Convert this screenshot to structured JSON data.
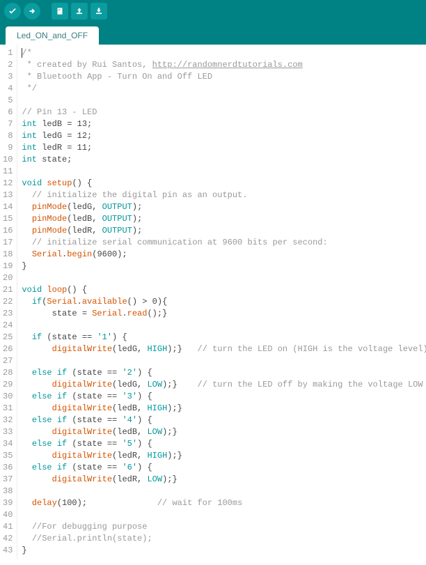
{
  "tab": {
    "title": "Led_ON_and_OFF"
  },
  "toolbar": {
    "verify": "verify-icon",
    "upload": "upload-icon",
    "new": "new-icon",
    "open": "open-icon",
    "save": "save-icon"
  },
  "code": {
    "lines": [
      {
        "n": 1,
        "seg": [
          {
            "c": "cm",
            "t": "/*"
          }
        ],
        "cursor": true
      },
      {
        "n": 2,
        "seg": [
          {
            "c": "cm",
            "t": " * created by Rui Santos, "
          },
          {
            "c": "cm-u",
            "t": "http://randomnerdtutorials.com"
          }
        ]
      },
      {
        "n": 3,
        "seg": [
          {
            "c": "cm",
            "t": " * Bluetooth App - Turn On and Off LED"
          }
        ]
      },
      {
        "n": 4,
        "seg": [
          {
            "c": "cm",
            "t": " */"
          }
        ]
      },
      {
        "n": 5,
        "seg": []
      },
      {
        "n": 6,
        "seg": [
          {
            "c": "cm",
            "t": "// Pin 13 - LED"
          }
        ]
      },
      {
        "n": 7,
        "seg": [
          {
            "c": "kw",
            "t": "int"
          },
          {
            "t": " ledB = 13;"
          }
        ]
      },
      {
        "n": 8,
        "seg": [
          {
            "c": "kw",
            "t": "int"
          },
          {
            "t": " ledG = 12;"
          }
        ]
      },
      {
        "n": 9,
        "seg": [
          {
            "c": "kw",
            "t": "int"
          },
          {
            "t": " ledR = 11;"
          }
        ]
      },
      {
        "n": 10,
        "seg": [
          {
            "c": "kw",
            "t": "int"
          },
          {
            "t": " state;"
          }
        ]
      },
      {
        "n": 11,
        "seg": []
      },
      {
        "n": 12,
        "seg": [
          {
            "c": "kw",
            "t": "void"
          },
          {
            "t": " "
          },
          {
            "c": "fn",
            "t": "setup"
          },
          {
            "t": "() {"
          }
        ]
      },
      {
        "n": 13,
        "seg": [
          {
            "t": "  "
          },
          {
            "c": "cm",
            "t": "// initialize the digital pin as an output."
          }
        ]
      },
      {
        "n": 14,
        "seg": [
          {
            "t": "  "
          },
          {
            "c": "fn",
            "t": "pinMode"
          },
          {
            "t": "(ledG, "
          },
          {
            "c": "cn",
            "t": "OUTPUT"
          },
          {
            "t": ");"
          }
        ]
      },
      {
        "n": 15,
        "seg": [
          {
            "t": "  "
          },
          {
            "c": "fn",
            "t": "pinMode"
          },
          {
            "t": "(ledB, "
          },
          {
            "c": "cn",
            "t": "OUTPUT"
          },
          {
            "t": ");"
          }
        ]
      },
      {
        "n": 16,
        "seg": [
          {
            "t": "  "
          },
          {
            "c": "fn",
            "t": "pinMode"
          },
          {
            "t": "(ledR, "
          },
          {
            "c": "cn",
            "t": "OUTPUT"
          },
          {
            "t": ");"
          }
        ]
      },
      {
        "n": 17,
        "seg": [
          {
            "t": "  "
          },
          {
            "c": "cm",
            "t": "// initialize serial communication at 9600 bits per second:"
          }
        ]
      },
      {
        "n": 18,
        "seg": [
          {
            "t": "  "
          },
          {
            "c": "fn",
            "t": "Serial"
          },
          {
            "t": "."
          },
          {
            "c": "fn",
            "t": "begin"
          },
          {
            "t": "(9600);"
          }
        ]
      },
      {
        "n": 19,
        "seg": [
          {
            "t": "}"
          }
        ]
      },
      {
        "n": 20,
        "seg": []
      },
      {
        "n": 21,
        "seg": [
          {
            "c": "kw",
            "t": "void"
          },
          {
            "t": " "
          },
          {
            "c": "fn",
            "t": "loop"
          },
          {
            "t": "() {"
          }
        ]
      },
      {
        "n": 22,
        "seg": [
          {
            "t": "  "
          },
          {
            "c": "kw",
            "t": "if"
          },
          {
            "t": "("
          },
          {
            "c": "fn",
            "t": "Serial"
          },
          {
            "t": "."
          },
          {
            "c": "fn",
            "t": "available"
          },
          {
            "t": "() > 0){"
          }
        ]
      },
      {
        "n": 23,
        "seg": [
          {
            "t": "      state = "
          },
          {
            "c": "fn",
            "t": "Serial"
          },
          {
            "t": "."
          },
          {
            "c": "fn",
            "t": "read"
          },
          {
            "t": "();}"
          }
        ]
      },
      {
        "n": 24,
        "seg": []
      },
      {
        "n": 25,
        "seg": [
          {
            "t": "  "
          },
          {
            "c": "kw",
            "t": "if"
          },
          {
            "t": " (state == "
          },
          {
            "c": "str",
            "t": "'1'"
          },
          {
            "t": ") {"
          }
        ]
      },
      {
        "n": 26,
        "seg": [
          {
            "t": "      "
          },
          {
            "c": "fn",
            "t": "digitalWrite"
          },
          {
            "t": "(ledG, "
          },
          {
            "c": "cn",
            "t": "HIGH"
          },
          {
            "t": ");}   "
          },
          {
            "c": "cm",
            "t": "// turn the LED on (HIGH is the voltage level)"
          }
        ]
      },
      {
        "n": 27,
        "seg": []
      },
      {
        "n": 28,
        "seg": [
          {
            "t": "  "
          },
          {
            "c": "kw",
            "t": "else"
          },
          {
            "t": " "
          },
          {
            "c": "kw",
            "t": "if"
          },
          {
            "t": " (state == "
          },
          {
            "c": "str",
            "t": "'2'"
          },
          {
            "t": ") {"
          }
        ]
      },
      {
        "n": 29,
        "seg": [
          {
            "t": "      "
          },
          {
            "c": "fn",
            "t": "digitalWrite"
          },
          {
            "t": "(ledG, "
          },
          {
            "c": "cn",
            "t": "LOW"
          },
          {
            "t": ");}    "
          },
          {
            "c": "cm",
            "t": "// turn the LED off by making the voltage LOW"
          }
        ]
      },
      {
        "n": 30,
        "seg": [
          {
            "t": "  "
          },
          {
            "c": "kw",
            "t": "else"
          },
          {
            "t": " "
          },
          {
            "c": "kw",
            "t": "if"
          },
          {
            "t": " (state == "
          },
          {
            "c": "str",
            "t": "'3'"
          },
          {
            "t": ") {"
          }
        ]
      },
      {
        "n": 31,
        "seg": [
          {
            "t": "      "
          },
          {
            "c": "fn",
            "t": "digitalWrite"
          },
          {
            "t": "(ledB, "
          },
          {
            "c": "cn",
            "t": "HIGH"
          },
          {
            "t": ");}"
          }
        ]
      },
      {
        "n": 32,
        "seg": [
          {
            "t": "  "
          },
          {
            "c": "kw",
            "t": "else"
          },
          {
            "t": " "
          },
          {
            "c": "kw",
            "t": "if"
          },
          {
            "t": " (state == "
          },
          {
            "c": "str",
            "t": "'4'"
          },
          {
            "t": ") {"
          }
        ]
      },
      {
        "n": 33,
        "seg": [
          {
            "t": "      "
          },
          {
            "c": "fn",
            "t": "digitalWrite"
          },
          {
            "t": "(ledB, "
          },
          {
            "c": "cn",
            "t": "LOW"
          },
          {
            "t": ");}"
          }
        ]
      },
      {
        "n": 34,
        "seg": [
          {
            "t": "  "
          },
          {
            "c": "kw",
            "t": "else"
          },
          {
            "t": " "
          },
          {
            "c": "kw",
            "t": "if"
          },
          {
            "t": " (state == "
          },
          {
            "c": "str",
            "t": "'5'"
          },
          {
            "t": ") {"
          }
        ]
      },
      {
        "n": 35,
        "seg": [
          {
            "t": "      "
          },
          {
            "c": "fn",
            "t": "digitalWrite"
          },
          {
            "t": "(ledR, "
          },
          {
            "c": "cn",
            "t": "HIGH"
          },
          {
            "t": ");}"
          }
        ]
      },
      {
        "n": 36,
        "seg": [
          {
            "t": "  "
          },
          {
            "c": "kw",
            "t": "else"
          },
          {
            "t": " "
          },
          {
            "c": "kw",
            "t": "if"
          },
          {
            "t": " (state == "
          },
          {
            "c": "str",
            "t": "'6'"
          },
          {
            "t": ") {"
          }
        ]
      },
      {
        "n": 37,
        "seg": [
          {
            "t": "      "
          },
          {
            "c": "fn",
            "t": "digitalWrite"
          },
          {
            "t": "(ledR, "
          },
          {
            "c": "cn",
            "t": "LOW"
          },
          {
            "t": ");}"
          }
        ]
      },
      {
        "n": 38,
        "seg": []
      },
      {
        "n": 39,
        "seg": [
          {
            "t": "  "
          },
          {
            "c": "fn",
            "t": "delay"
          },
          {
            "t": "(100);              "
          },
          {
            "c": "cm",
            "t": "// wait for 100ms"
          }
        ]
      },
      {
        "n": 40,
        "seg": []
      },
      {
        "n": 41,
        "seg": [
          {
            "t": "  "
          },
          {
            "c": "cm",
            "t": "//For debugging purpose"
          }
        ]
      },
      {
        "n": 42,
        "seg": [
          {
            "t": "  "
          },
          {
            "c": "cm",
            "t": "//Serial.println(state);"
          }
        ]
      },
      {
        "n": 43,
        "seg": [
          {
            "t": "}"
          }
        ]
      }
    ]
  }
}
